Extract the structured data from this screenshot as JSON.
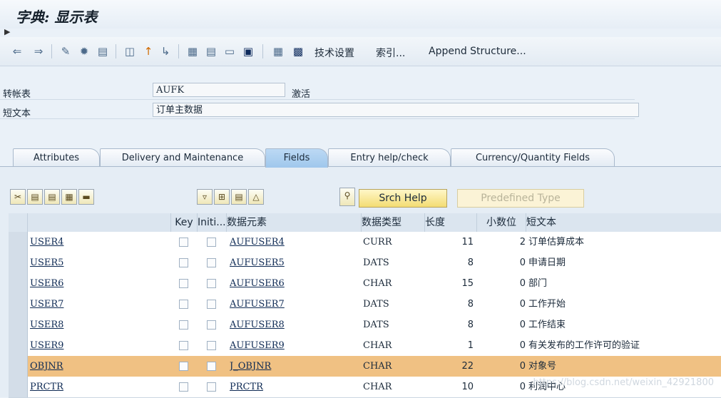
{
  "window": {
    "title": "字典: 显示表"
  },
  "toolbar": {
    "icons": [
      "back-icon",
      "forward-icon",
      "change-display-icon",
      "activate-icon",
      "where-used-icon",
      "object-list-icon",
      "up-icon",
      "navigation-icon",
      "hierarchy-icon",
      "table-contents-icon",
      "screen-icon",
      "information-icon",
      "technical-icon",
      "grid-icon"
    ],
    "tech_settings": "技术设置",
    "index": "索引...",
    "append_structure": "Append Structure..."
  },
  "header": {
    "table_label": "转帐表",
    "table_value": "AUFK",
    "status": "激活",
    "short_text_label": "短文本",
    "short_text_value": "订单主数据"
  },
  "tabs": [
    {
      "label": "Attributes",
      "active": false
    },
    {
      "label": "Delivery and Maintenance",
      "active": false
    },
    {
      "label": "Fields",
      "active": true
    },
    {
      "label": "Entry help/check",
      "active": false
    },
    {
      "label": "Currency/Quantity Fields",
      "active": false
    }
  ],
  "grid_toolbar": {
    "srch_help": "Srch Help",
    "predefined_type": "Predefined Type"
  },
  "columns": {
    "field": "",
    "key": "Key",
    "initial": "Initi...",
    "data_element": "数据元素",
    "data_type": "数据类型",
    "length": "长度",
    "decimals": "小数位",
    "short_text": "短文本"
  },
  "rows": [
    {
      "field": "USER4",
      "data_element": "AUFUSER4",
      "data_type": "CURR",
      "length": "11",
      "decimals": "2",
      "short_text": "订单估算成本"
    },
    {
      "field": "USER5",
      "data_element": "AUFUSER5",
      "data_type": "DATS",
      "length": "8",
      "decimals": "0",
      "short_text": "申请日期"
    },
    {
      "field": "USER6",
      "data_element": "AUFUSER6",
      "data_type": "CHAR",
      "length": "15",
      "decimals": "0",
      "short_text": "部门"
    },
    {
      "field": "USER7",
      "data_element": "AUFUSER7",
      "data_type": "DATS",
      "length": "8",
      "decimals": "0",
      "short_text": "工作开始"
    },
    {
      "field": "USER8",
      "data_element": "AUFUSER8",
      "data_type": "DATS",
      "length": "8",
      "decimals": "0",
      "short_text": "工作结束"
    },
    {
      "field": "USER9",
      "data_element": "AUFUSER9",
      "data_type": "CHAR",
      "length": "1",
      "decimals": "0",
      "short_text": "有关发布的工作许可的验证"
    },
    {
      "field": "OBJNR",
      "data_element": "J_OBJNR",
      "data_type": "CHAR",
      "length": "22",
      "decimals": "0",
      "short_text": "对象号"
    },
    {
      "field": "PRCTR",
      "data_element": "PRCTR",
      "data_type": "CHAR",
      "length": "10",
      "decimals": "0",
      "short_text": "利润中心"
    }
  ],
  "watermark": "https://blog.csdn.net/weixin_42921800"
}
